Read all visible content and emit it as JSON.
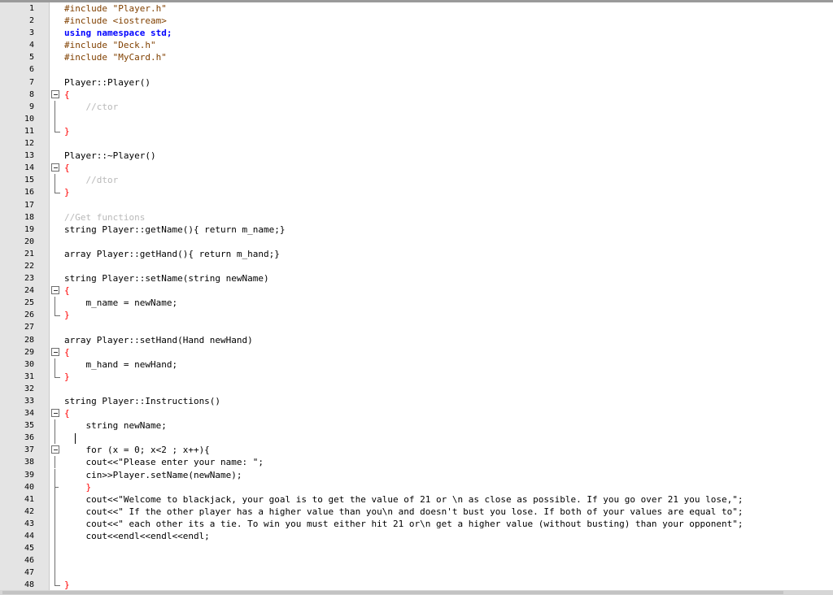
{
  "editor": {
    "lines": [
      {
        "n": "1",
        "code": "#include \"Player.h\""
      },
      {
        "n": "2",
        "code": "#include <iostream>"
      },
      {
        "n": "3",
        "code": "using namespace std;"
      },
      {
        "n": "4",
        "code": "#include \"Deck.h\""
      },
      {
        "n": "5",
        "code": "#include \"MyCard.h\""
      },
      {
        "n": "6",
        "code": ""
      },
      {
        "n": "7",
        "code": "Player::Player()"
      },
      {
        "n": "8",
        "code": "{"
      },
      {
        "n": "9",
        "code": "    //ctor"
      },
      {
        "n": "10",
        "code": ""
      },
      {
        "n": "11",
        "code": "}"
      },
      {
        "n": "12",
        "code": ""
      },
      {
        "n": "13",
        "code": "Player::~Player()"
      },
      {
        "n": "14",
        "code": "{"
      },
      {
        "n": "15",
        "code": "    //dtor"
      },
      {
        "n": "16",
        "code": "}"
      },
      {
        "n": "17",
        "code": ""
      },
      {
        "n": "18",
        "code": "//Get functions"
      },
      {
        "n": "19",
        "code": "string Player::getName(){ return m_name;}"
      },
      {
        "n": "20",
        "code": ""
      },
      {
        "n": "21",
        "code": "array Player::getHand(){ return m_hand;}"
      },
      {
        "n": "22",
        "code": ""
      },
      {
        "n": "23",
        "code": "string Player::setName(string newName)"
      },
      {
        "n": "24",
        "code": "{"
      },
      {
        "n": "25",
        "code": "    m_name = newName;"
      },
      {
        "n": "26",
        "code": "}"
      },
      {
        "n": "27",
        "code": ""
      },
      {
        "n": "28",
        "code": "array Player::setHand(Hand newHand)"
      },
      {
        "n": "29",
        "code": "{"
      },
      {
        "n": "30",
        "code": "    m_hand = newHand;"
      },
      {
        "n": "31",
        "code": "}"
      },
      {
        "n": "32",
        "code": ""
      },
      {
        "n": "33",
        "code": "string Player::Instructions()"
      },
      {
        "n": "34",
        "code": "{"
      },
      {
        "n": "35",
        "code": "    string newName;"
      },
      {
        "n": "36",
        "code": ""
      },
      {
        "n": "37",
        "code": "    for (x = 0; x<2 ; x++){"
      },
      {
        "n": "38",
        "code": "    cout<<\"Please enter your name: \";"
      },
      {
        "n": "39",
        "code": "    cin>>Player.setName(newName);"
      },
      {
        "n": "40",
        "code": "    }"
      },
      {
        "n": "41",
        "code": "    cout<<\"Welcome to blackjack, your goal is to get the value of 21 or \\n as close as possible. If you go over 21 you lose,\";"
      },
      {
        "n": "42",
        "code": "    cout<<\" If the other player has a higher value than you\\n and doesn't bust you lose. If both of your values are equal to\";"
      },
      {
        "n": "43",
        "code": "    cout<<\" each other its a tie. To win you must either hit 21 or\\n get a higher value (without busting) than your opponent\";"
      },
      {
        "n": "44",
        "code": "    cout<<endl<<endl<<endl;"
      },
      {
        "n": "45",
        "code": ""
      },
      {
        "n": "46",
        "code": ""
      },
      {
        "n": "47",
        "code": ""
      },
      {
        "n": "48",
        "code": "}"
      }
    ]
  },
  "colors": {
    "preprocessor": "#804000",
    "keyword": "#0000ff",
    "type": "#8000ff",
    "string": "#808080",
    "comment": "#b9b9b9",
    "operator": "#ff0000",
    "number": "#ff8000",
    "gutter": "#e4e4e4"
  }
}
